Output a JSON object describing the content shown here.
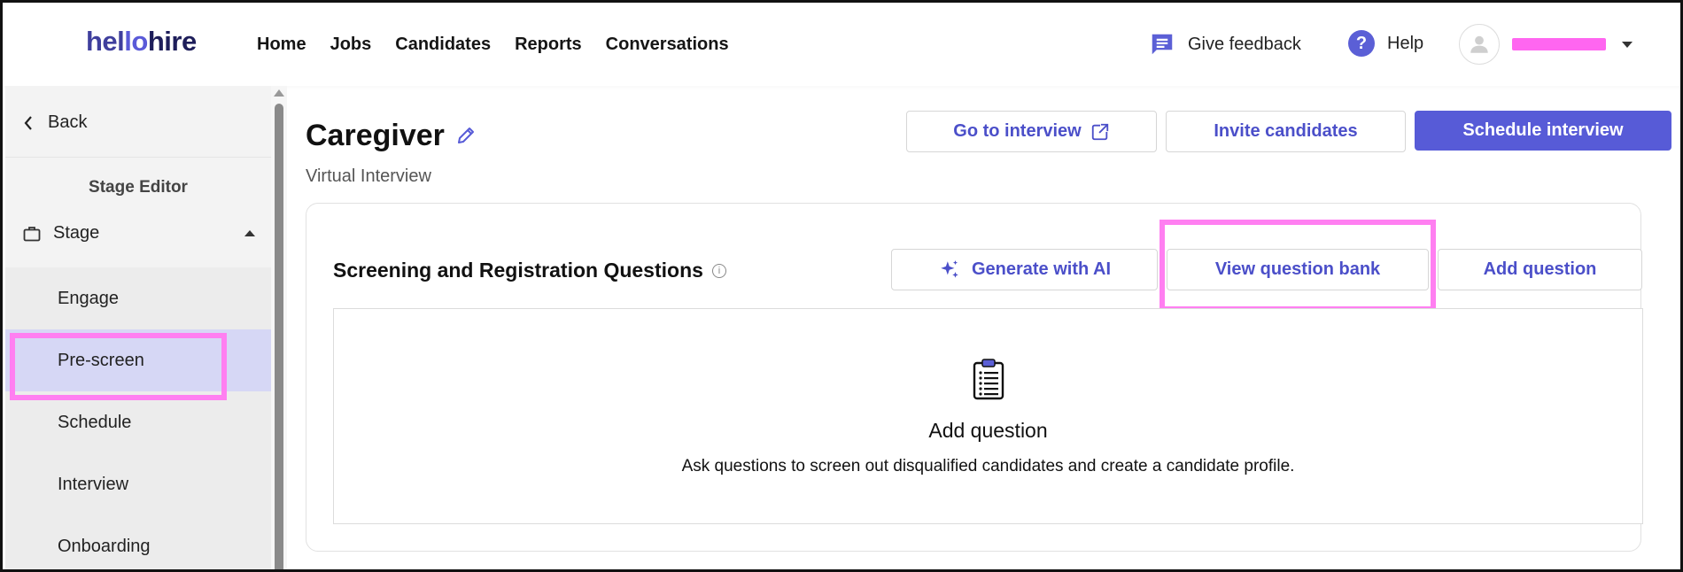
{
  "brand": {
    "logo_part1": "hel",
    "logo_part2": "lo",
    "logo_part3": "hire"
  },
  "nav": {
    "items": [
      "Home",
      "Jobs",
      "Candidates",
      "Reports",
      "Conversations"
    ]
  },
  "header": {
    "feedback_label": "Give feedback",
    "help_label": "Help",
    "user_name": "████████"
  },
  "sidebar": {
    "back_label": "Back",
    "section_title": "Stage Editor",
    "stage_label": "Stage",
    "items": [
      {
        "label": "Engage",
        "active": false
      },
      {
        "label": "Pre-screen",
        "active": true
      },
      {
        "label": "Schedule",
        "active": false
      },
      {
        "label": "Interview",
        "active": false
      },
      {
        "label": "Onboarding",
        "active": false
      }
    ]
  },
  "page": {
    "title": "Caregiver",
    "subtitle": "Virtual Interview",
    "actions": {
      "go_to_interview": "Go to interview",
      "invite_candidates": "Invite candidates",
      "schedule_interview": "Schedule interview"
    }
  },
  "questions": {
    "section_title": "Screening and Registration Questions",
    "info_symbol": "i",
    "generate_ai": "Generate with AI",
    "view_bank": "View question bank",
    "add_question": "Add question",
    "empty_title": "Add question",
    "empty_desc": "Ask questions to screen out disqualified candidates and create a candidate profile."
  },
  "colors": {
    "accent": "#575bd7",
    "highlight": "#ff7ff1",
    "active_stage_bg": "#d6d7f5"
  }
}
